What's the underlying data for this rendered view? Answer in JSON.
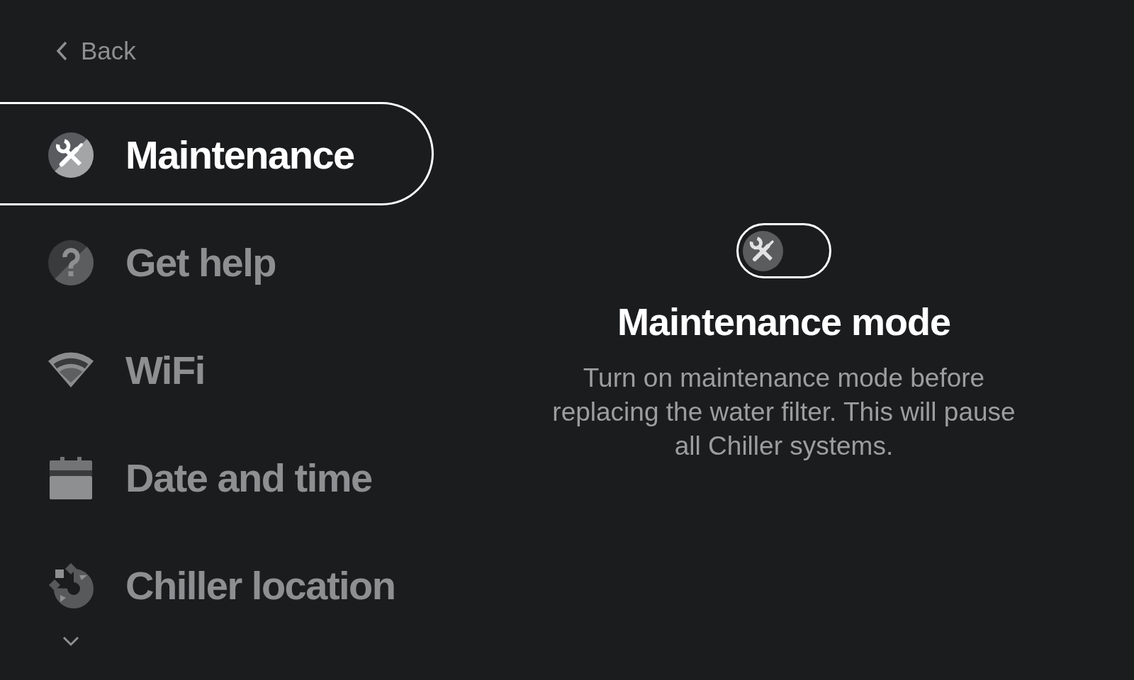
{
  "back": {
    "label": "Back"
  },
  "menu": {
    "items": [
      {
        "label": "Maintenance",
        "selected": true
      },
      {
        "label": "Get help",
        "selected": false
      },
      {
        "label": "WiFi",
        "selected": false
      },
      {
        "label": "Date and time",
        "selected": false
      },
      {
        "label": "Chiller location",
        "selected": false
      }
    ]
  },
  "detail": {
    "toggle": {
      "on": false
    },
    "title": "Maintenance mode",
    "description": "Turn on maintenance mode before replacing the water filter. This will pause all Chiller systems."
  }
}
